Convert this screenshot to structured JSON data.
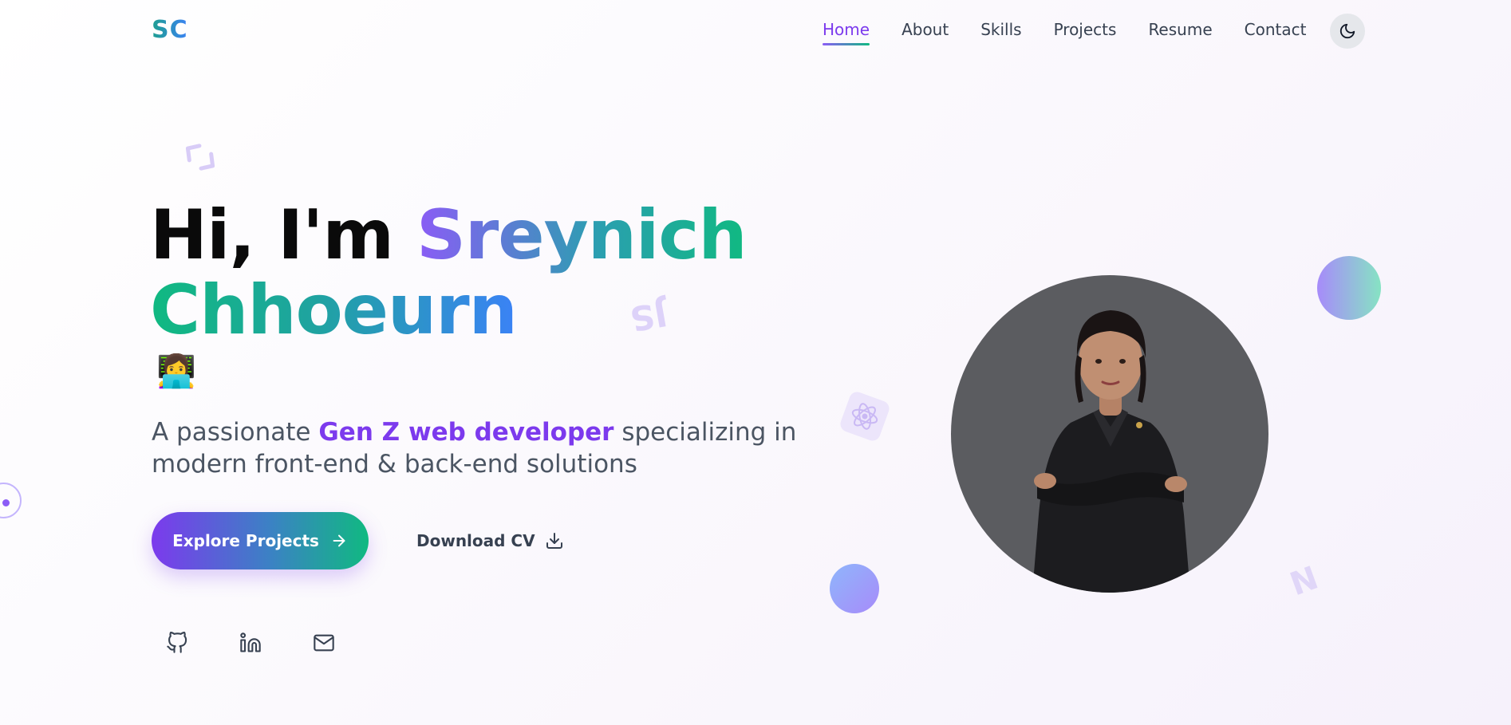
{
  "nav": {
    "logo": "SC",
    "links": [
      {
        "label": "Home",
        "active": true
      },
      {
        "label": "About"
      },
      {
        "label": "Skills"
      },
      {
        "label": "Projects"
      },
      {
        "label": "Resume"
      },
      {
        "label": "Contact"
      }
    ],
    "theme_toggle_icon": "moon-icon"
  },
  "hero": {
    "greeting": "Hi, I'm ",
    "first_name": "Sreynich",
    "last_name": "Chhoeurn",
    "emoji": "👩‍💻",
    "subtitle_pre": "A passionate ",
    "subtitle_highlight": "Gen Z web developer",
    "subtitle_post": " specializing in modern front-end & back-end solutions",
    "primary_button": "Explore Projects",
    "secondary_button": "Download CV"
  },
  "social": [
    "github-icon",
    "linkedin-icon",
    "mail-icon"
  ],
  "decorations": {
    "code_symbol": "</>",
    "js_label": "JS",
    "n_label": "N"
  },
  "colors": {
    "accent_purple": "#7c3aed",
    "accent_green": "#10b981",
    "accent_blue": "#3b82f6"
  }
}
